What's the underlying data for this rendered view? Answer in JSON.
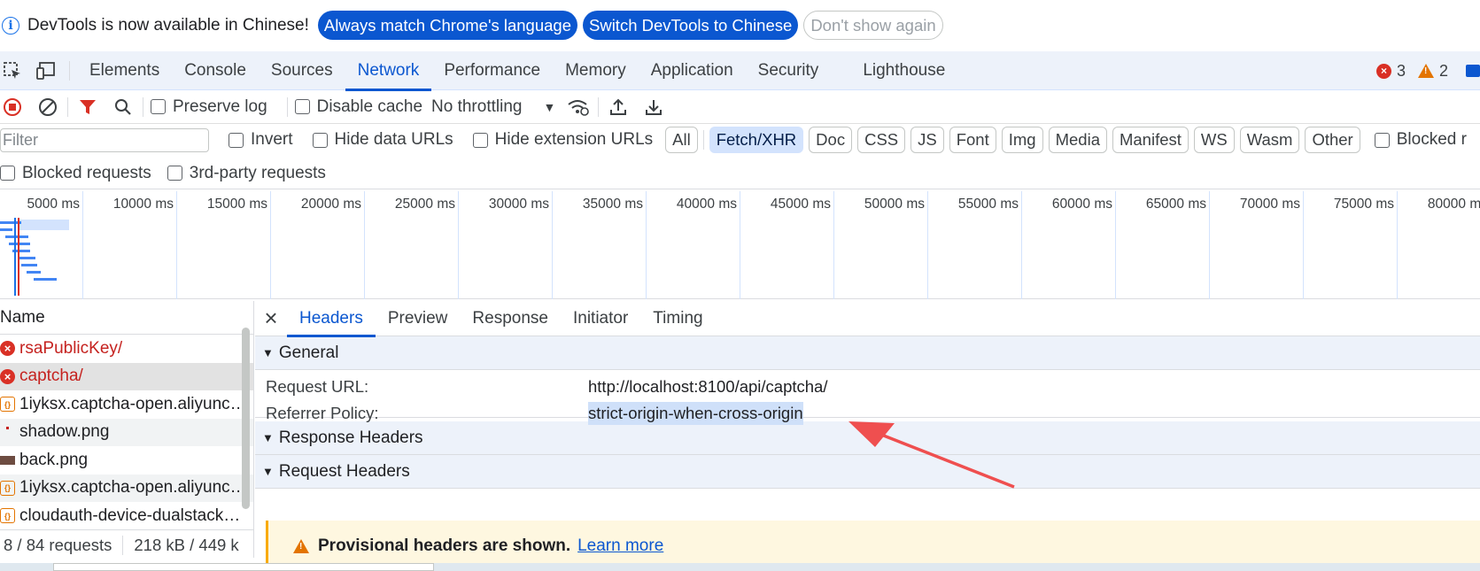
{
  "infobar": {
    "message": "DevTools is now available in Chinese!",
    "btn_match": "Always match Chrome's language",
    "btn_switch": "Switch DevTools to Chinese",
    "btn_dismiss": "Don't show again"
  },
  "tabs": {
    "items": [
      "Elements",
      "Console",
      "Sources",
      "Network",
      "Performance",
      "Memory",
      "Application",
      "Security",
      "Lighthouse"
    ],
    "active": "Network",
    "errors_count": "3",
    "warnings_count": "2"
  },
  "toolbar": {
    "preserve_log": "Preserve log",
    "disable_cache": "Disable cache",
    "throttling": "No throttling"
  },
  "filter": {
    "placeholder": "Filter",
    "invert": "Invert",
    "hide_data_urls": "Hide data URLs",
    "hide_extension_urls": "Hide extension URLs",
    "types": [
      "All",
      "Fetch/XHR",
      "Doc",
      "CSS",
      "JS",
      "Font",
      "Img",
      "Media",
      "Manifest",
      "WS",
      "Wasm",
      "Other"
    ],
    "active_type": "Fetch/XHR",
    "blocked_cookies_truncated": "Blocked r",
    "blocked_requests": "Blocked requests",
    "third_party": "3rd-party requests"
  },
  "timeline": {
    "ticks": [
      "5000 ms",
      "10000 ms",
      "15000 ms",
      "20000 ms",
      "25000 ms",
      "30000 ms",
      "35000 ms",
      "40000 ms",
      "45000 ms",
      "50000 ms",
      "55000 ms",
      "60000 ms",
      "65000 ms",
      "70000 ms",
      "75000 ms",
      "80000 ms"
    ]
  },
  "requests": {
    "column_name": "Name",
    "rows": [
      {
        "name": "rsaPublicKey/",
        "kind": "error"
      },
      {
        "name": "captcha/",
        "kind": "error"
      },
      {
        "name": "1iyksx.captcha-open.aliyunc…",
        "kind": "js"
      },
      {
        "name": "shadow.png",
        "kind": "dot"
      },
      {
        "name": "back.png",
        "kind": "img"
      },
      {
        "name": "1iyksx.captcha-open.aliyunc…",
        "kind": "js"
      },
      {
        "name": "cloudauth-device-dualstack…",
        "kind": "js"
      }
    ],
    "status_requests": "8 / 84 requests",
    "status_size": "218 kB / 449 k"
  },
  "details": {
    "tabs": [
      "Headers",
      "Preview",
      "Response",
      "Initiator",
      "Timing"
    ],
    "active_tab": "Headers",
    "general_title": "General",
    "request_url_key": "Request URL:",
    "request_url_value": "http://localhost:8100/api/captcha/",
    "referrer_key": "Referrer Policy:",
    "referrer_value": "strict-origin-when-cross-origin",
    "response_headers_title": "Response Headers",
    "request_headers_title": "Request Headers",
    "provisional_text": "Provisional headers are shown.",
    "learn_more": "Learn more"
  },
  "colors": {
    "accent": "#0b57d0",
    "error": "#d93025",
    "annotation_arrow": "#ef4f4f"
  }
}
